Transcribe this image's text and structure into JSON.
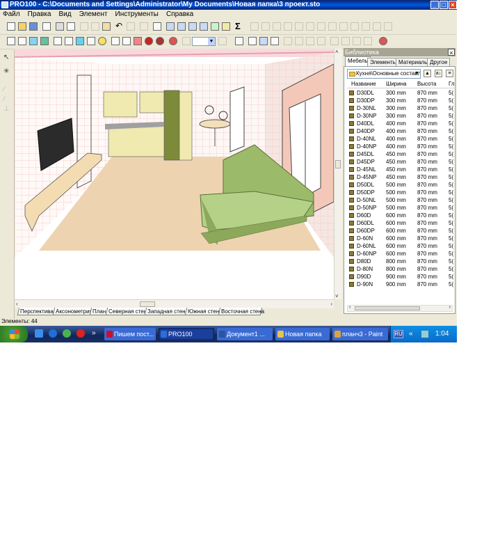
{
  "window": {
    "title": "PRO100 - C:\\Documents and Settings\\Administrator\\My Documents\\Новая папка\\3 проект.sto"
  },
  "menu": [
    "Файл",
    "Правка",
    "Вид",
    "Элемент",
    "Инструменты",
    "Справка"
  ],
  "toolbar": {
    "sigma_label": "Σ"
  },
  "view_tabs": [
    "Перспектива",
    "Аксонометрия",
    "План",
    "Северная стена",
    "Западная стена",
    "Южная стена",
    "Восточная стена"
  ],
  "status_text": "Элементы: 44",
  "library": {
    "title": "Библиотека",
    "tabs": [
      "Мебель",
      "Элементы",
      "Материалы",
      "Другое"
    ],
    "active_tab": "Мебель",
    "folder": "Кухня\\Основные составляющие",
    "columns": [
      "Название",
      "Ширина",
      "Высота",
      "Гл"
    ],
    "items": [
      {
        "name": "D30DL",
        "width": "300 mm",
        "height": "870 mm",
        "depth": "5("
      },
      {
        "name": "D30DP",
        "width": "300 mm",
        "height": "870 mm",
        "depth": "5("
      },
      {
        "name": "D-30NL",
        "width": "300 mm",
        "height": "870 mm",
        "depth": "5("
      },
      {
        "name": "D-30NP",
        "width": "300 mm",
        "height": "870 mm",
        "depth": "5("
      },
      {
        "name": "D40DL",
        "width": "400 mm",
        "height": "870 mm",
        "depth": "5("
      },
      {
        "name": "D40DP",
        "width": "400 mm",
        "height": "870 mm",
        "depth": "5("
      },
      {
        "name": "D-40NL",
        "width": "400 mm",
        "height": "870 mm",
        "depth": "5("
      },
      {
        "name": "D-40NP",
        "width": "400 mm",
        "height": "870 mm",
        "depth": "5("
      },
      {
        "name": "D45DL",
        "width": "450 mm",
        "height": "870 mm",
        "depth": "5("
      },
      {
        "name": "D45DP",
        "width": "450 mm",
        "height": "870 mm",
        "depth": "5("
      },
      {
        "name": "D-45NL",
        "width": "450 mm",
        "height": "870 mm",
        "depth": "5("
      },
      {
        "name": "D-45NP",
        "width": "450 mm",
        "height": "870 mm",
        "depth": "5("
      },
      {
        "name": "D50DL",
        "width": "500 mm",
        "height": "870 mm",
        "depth": "5("
      },
      {
        "name": "D50DP",
        "width": "500 mm",
        "height": "870 mm",
        "depth": "5("
      },
      {
        "name": "D-50NL",
        "width": "500 mm",
        "height": "870 mm",
        "depth": "5("
      },
      {
        "name": "D-50NP",
        "width": "500 mm",
        "height": "870 mm",
        "depth": "5("
      },
      {
        "name": "D60D",
        "width": "600 mm",
        "height": "870 mm",
        "depth": "5("
      },
      {
        "name": "D60DL",
        "width": "600 mm",
        "height": "870 mm",
        "depth": "5("
      },
      {
        "name": "D60DP",
        "width": "600 mm",
        "height": "870 mm",
        "depth": "5("
      },
      {
        "name": "D-60N",
        "width": "600 mm",
        "height": "870 mm",
        "depth": "5("
      },
      {
        "name": "D-60NL",
        "width": "600 mm",
        "height": "870 mm",
        "depth": "5("
      },
      {
        "name": "D-60NP",
        "width": "600 mm",
        "height": "870 mm",
        "depth": "5("
      },
      {
        "name": "D80D",
        "width": "800 mm",
        "height": "870 mm",
        "depth": "5("
      },
      {
        "name": "D-80N",
        "width": "800 mm",
        "height": "870 mm",
        "depth": "5("
      },
      {
        "name": "D90D",
        "width": "900 mm",
        "height": "870 mm",
        "depth": "5("
      },
      {
        "name": "D-90N",
        "width": "900 mm",
        "height": "870 mm",
        "depth": "5("
      }
    ]
  },
  "taskbar": {
    "tasks": [
      {
        "label": "Пишем пост...",
        "icon_color": "#c8102e"
      },
      {
        "label": "PRO100",
        "icon_color": "#2a6fd6"
      },
      {
        "label": "Документ1 ...",
        "icon_color": "#2b579a"
      },
      {
        "label": "Новая папка",
        "icon_color": "#e8c34d"
      },
      {
        "label": "планч3 - Paint",
        "icon_color": "#d9a441"
      }
    ],
    "active_task": "PRO100",
    "language": "RU",
    "clock": "1:04"
  },
  "colors": {
    "title_bar": "#0a246a",
    "sofa": "#9bbb6a",
    "floor": "#eed3b0",
    "kitchen_cabinets": "#f0eab0"
  }
}
